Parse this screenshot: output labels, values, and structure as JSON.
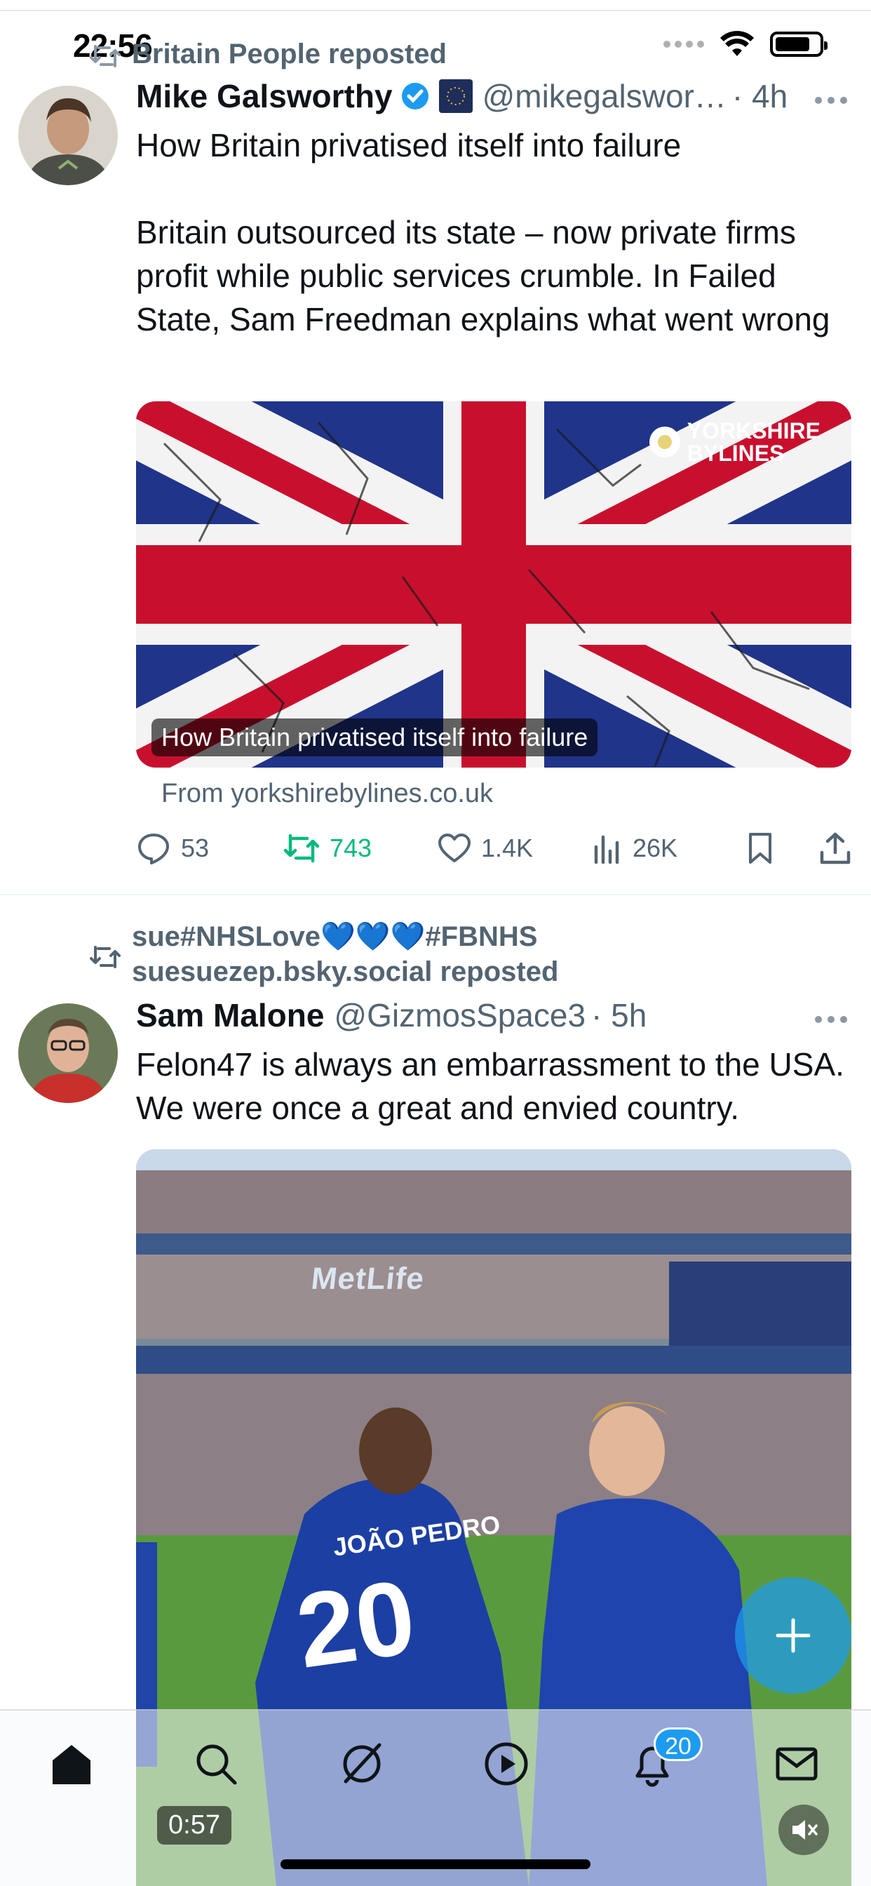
{
  "status_bar": {
    "time": "22:56"
  },
  "posts": [
    {
      "repost_by": "Britain People reposted",
      "author_name": "Mike Galsworthy",
      "handle": "@mikegalswor…",
      "time": "· 4h",
      "text_line1": "How Britain privatised itself into failure",
      "text_line2": "Britain outsourced its state – now private firms profit while public services crumble. In Failed State, Sam Freedman explains what went wrong",
      "card": {
        "caption": "How Britain privatised itself into failure",
        "brand_line1": "YORKSHIRE",
        "brand_line2": "BYLINES",
        "from": "From yorkshirebylines.co.uk"
      },
      "stats": {
        "replies": "53",
        "reposts": "743",
        "likes": "1.4K",
        "views": "26K"
      }
    },
    {
      "repost_by_line1": "sue#NHSLove💙💙💙#FBNHS",
      "repost_by_line2": "suesuezep.bsky.social reposted",
      "author_name": "Sam Malone",
      "handle": "@GizmosSpace3",
      "time": "· 5h",
      "text": "Felon47 is always an embarrassment to the USA. We were once a great and envied country.",
      "video": {
        "stadium_sign": "MetLife",
        "shirt_name": "JOÃO PEDRO",
        "shirt_number": "20",
        "duration": "0:57"
      }
    }
  ],
  "tabbar": {
    "notification_count": "20"
  },
  "colors": {
    "accent": "#1d9bf0",
    "repost_green": "#00ba7c",
    "muted": "#536471"
  }
}
